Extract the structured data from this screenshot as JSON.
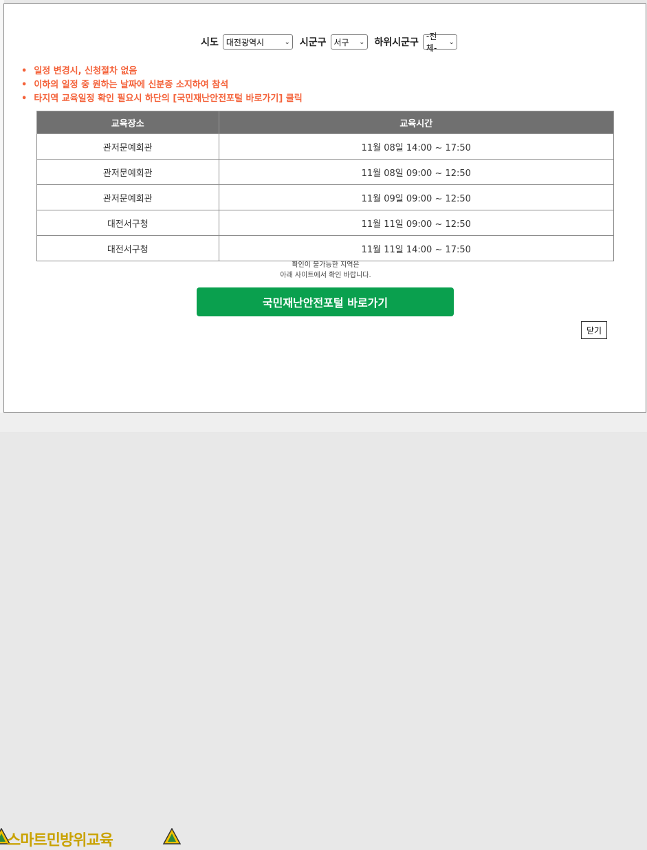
{
  "filters": {
    "sido_label": "시도",
    "sido_value": "대전광역시",
    "sigungu_label": "시군구",
    "sigungu_value": "서구",
    "sub_label": "하위시군구",
    "sub_value": "-전체-"
  },
  "notices": [
    "일정 변경시, 신청절차 없음",
    "이하의 일정 중 원하는 날짜에 신분증 소지하여 참석",
    "타지역 교육일정 확인 필요시 하단의 [국민재난안전포털 바로가기] 클릭"
  ],
  "table": {
    "headers": [
      "교육장소",
      "교육시간"
    ],
    "rows": [
      {
        "place": "관저문예회관",
        "time": "11월 08일 14:00 ~ 17:50"
      },
      {
        "place": "관저문예회관",
        "time": "11월 08일 09:00 ~ 12:50"
      },
      {
        "place": "관저문예회관",
        "time": "11월 09일 09:00 ~ 12:50"
      },
      {
        "place": "대전서구청",
        "time": "11월 11일 09:00 ~ 12:50"
      },
      {
        "place": "대전서구청",
        "time": "11월 11일 14:00 ~ 17:50"
      }
    ]
  },
  "footnote": {
    "line1": "확인이 불가능한 지역은",
    "line2": "아래 사이트에서 확인 바랍니다."
  },
  "buttons": {
    "portal": "국민재난안전포털 바로가기",
    "close": "닫기"
  },
  "background": {
    "logo_text": "스마트민방위교육"
  },
  "colors": {
    "notice": "#f4623a",
    "header_bg": "#707070",
    "portal_button": "#0aa04e"
  }
}
